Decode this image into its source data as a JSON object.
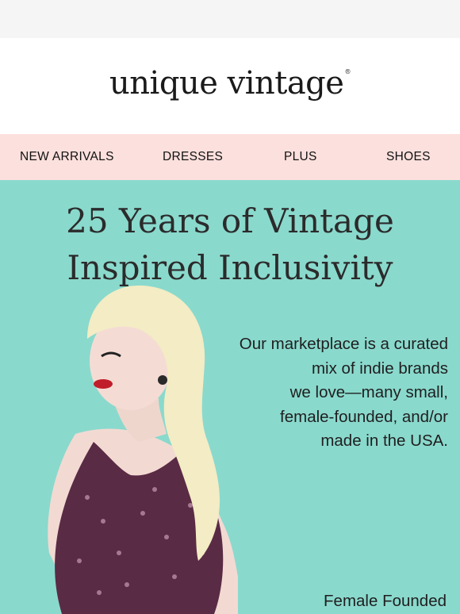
{
  "brand": {
    "logo_text": "unique vintage",
    "logo_mark": "®"
  },
  "nav": {
    "items": [
      {
        "label": "NEW ARRIVALS"
      },
      {
        "label": "DRESSES"
      },
      {
        "label": "PLUS"
      },
      {
        "label": "SHOES"
      }
    ]
  },
  "hero": {
    "headline_line1": "25 Years of Vintage",
    "headline_line2": "Inspired Inclusivity",
    "copy_lines": [
      "Our marketplace is a curated",
      "mix of indie brands",
      "we love—many small,",
      "female-founded, and/or",
      "made in the USA."
    ],
    "footer_label": "Female Founded"
  },
  "colors": {
    "hero_bg": "#8ad9cd",
    "nav_bg": "#fbe0dd",
    "logo_bg": "#ffffff",
    "text": "#1f1f1f"
  }
}
